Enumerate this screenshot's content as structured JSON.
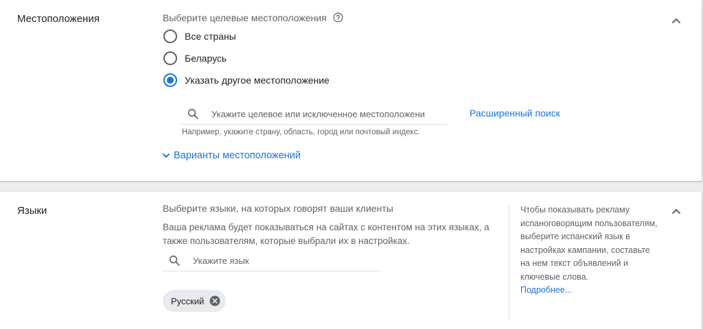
{
  "locations": {
    "title": "Местоположения",
    "prompt": "Выберите целевые местоположения",
    "options": [
      {
        "label": "Все страны",
        "selected": false
      },
      {
        "label": "Беларусь",
        "selected": false
      },
      {
        "label": "Указать другое местоположение",
        "selected": true
      }
    ],
    "search_placeholder": "Укажите целевое или исключенное местоположение",
    "advanced_search": "Расширенный поиск",
    "hint": "Например, укажите страну, область, город или почтовый индекс.",
    "options_toggle": "Варианты местоположений"
  },
  "languages": {
    "title": "Языки",
    "prompt": "Выберите языки, на которых говорят ваши клиенты",
    "description": "Ваша реклама будет показываться на сайтах с контентом на этих языках, а также пользователям, которые выбрали их в настройках.",
    "search_placeholder": "Укажите язык",
    "selected_chip": "Русский",
    "side_help": "Чтобы показывать рекламу испаноговорящим пользователям, выберите испанский язык в настройках кампании, составьте на нем текст объявлений и ключевые слова.",
    "side_help_link": "Подробнее..."
  },
  "colors": {
    "accent": "#1a73e8",
    "text_secondary": "#5f6368",
    "chip_bg": "#e8eaed"
  }
}
